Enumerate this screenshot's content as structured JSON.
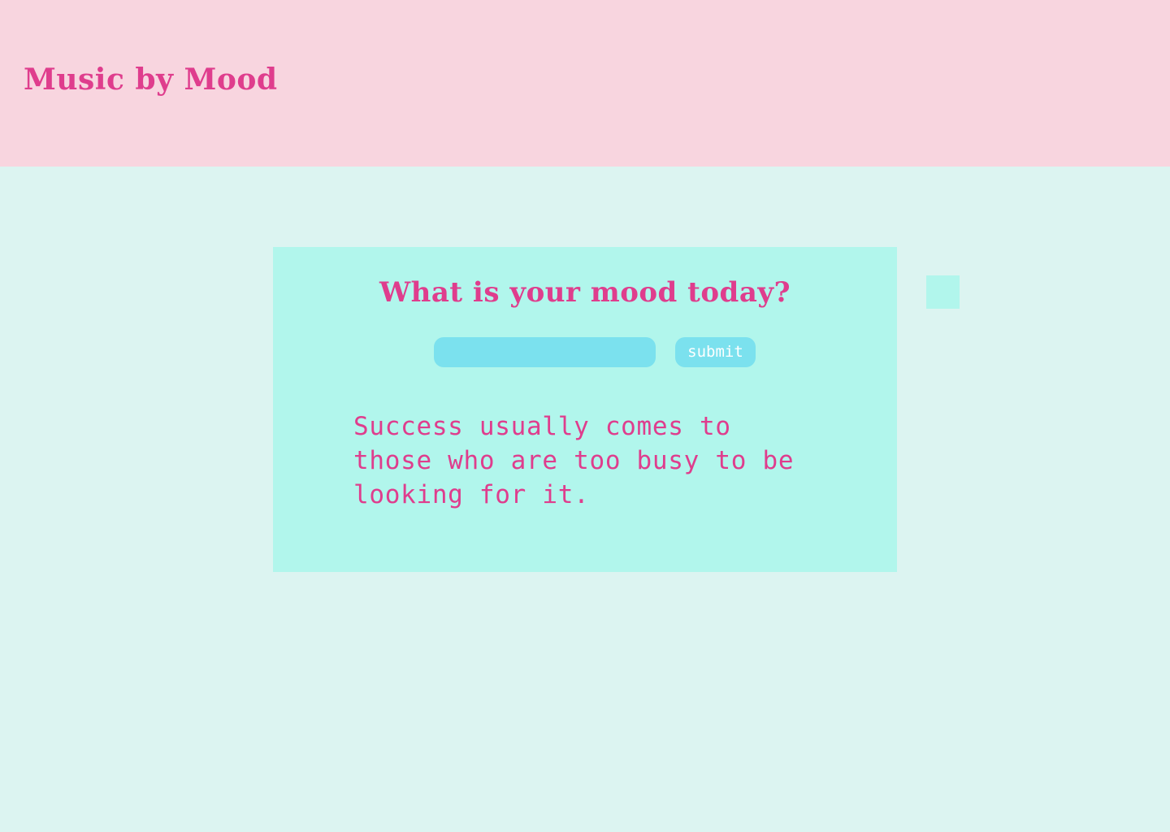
{
  "header": {
    "title": "Music by Mood"
  },
  "mood_card": {
    "heading": "What is your mood today?",
    "input": {
      "value": "",
      "placeholder": ""
    },
    "submit_label": "submit",
    "quote": "Success usually comes to those who are too busy to be looking for it."
  },
  "colors": {
    "header_background": "#f8d5df",
    "page_background": "#dcf4f1",
    "panel_background": "#b1f6ec",
    "accent_text": "#df3d8d",
    "control_background": "#7be1ee",
    "control_text": "#ffffff"
  }
}
